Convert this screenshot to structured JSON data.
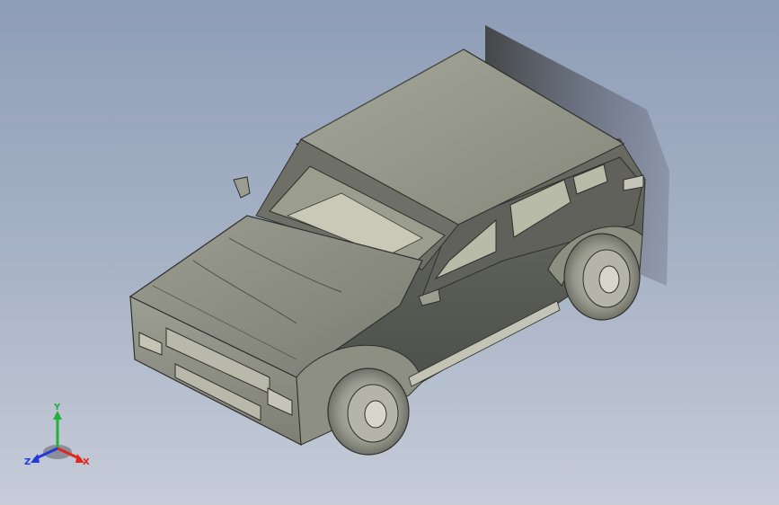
{
  "viewport": {
    "background_top": "#8e9db7",
    "background_bottom": "#c6ccd8",
    "model": "suv-car-3d-model",
    "body_color": "#86877d",
    "highlight_color": "#b2b3a6",
    "shadow_color": "#3d3f3b"
  },
  "triad": {
    "x_label": "X",
    "y_label": "Y",
    "z_label": "Z",
    "x_color": "#e0281e",
    "y_color": "#22b03a",
    "z_color": "#2338d6"
  }
}
